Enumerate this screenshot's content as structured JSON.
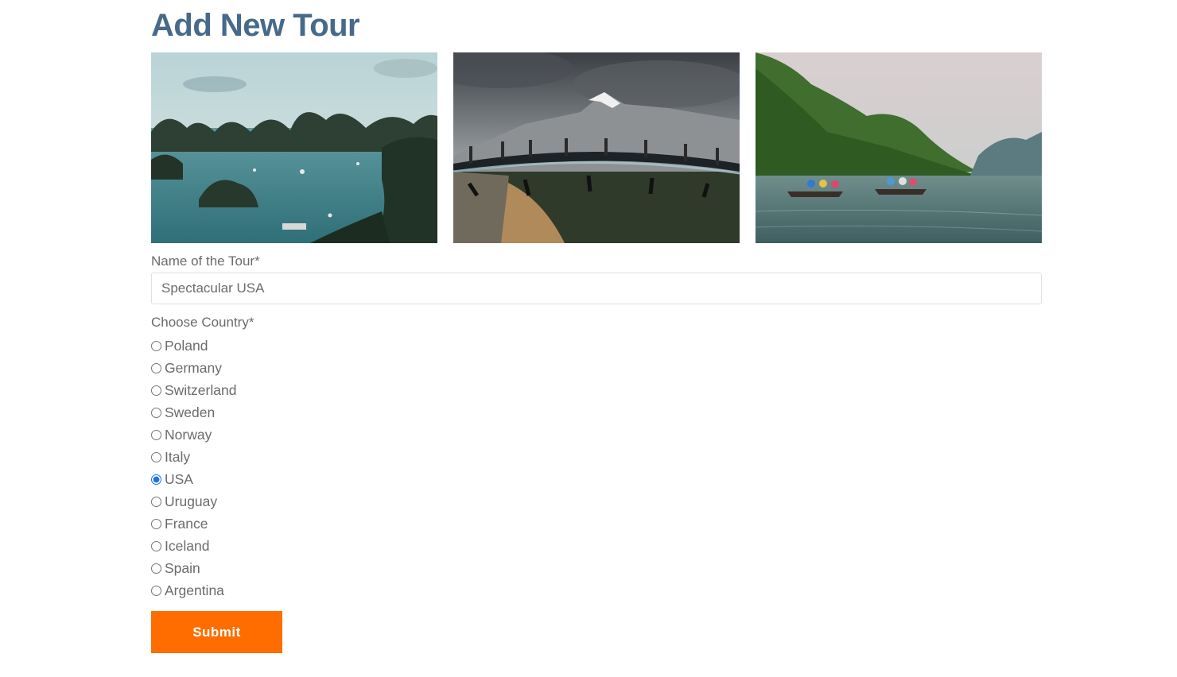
{
  "page": {
    "title": "Add New Tour"
  },
  "gallery": {
    "images": [
      {
        "name": "bay-islands-photo"
      },
      {
        "name": "glass-skywalk-photo"
      },
      {
        "name": "river-boats-photo"
      }
    ]
  },
  "form": {
    "name_label": "Name of the Tour*",
    "name_value": "Spectacular USA",
    "country_label": "Choose Country*",
    "countries": [
      {
        "label": "Poland",
        "checked": false
      },
      {
        "label": "Germany",
        "checked": false
      },
      {
        "label": "Switzerland",
        "checked": false
      },
      {
        "label": "Sweden",
        "checked": false
      },
      {
        "label": "Norway",
        "checked": false
      },
      {
        "label": "Italy",
        "checked": false
      },
      {
        "label": "USA",
        "checked": true
      },
      {
        "label": "Uruguay",
        "checked": false
      },
      {
        "label": "France",
        "checked": false
      },
      {
        "label": "Iceland",
        "checked": false
      },
      {
        "label": "Spain",
        "checked": false
      },
      {
        "label": "Argentina",
        "checked": false
      }
    ],
    "submit_label": "Submit"
  },
  "colors": {
    "title": "#47698a",
    "text": "#6b6b6b",
    "submit_bg": "#ff6d00",
    "input_border": "#e0e0e0"
  }
}
